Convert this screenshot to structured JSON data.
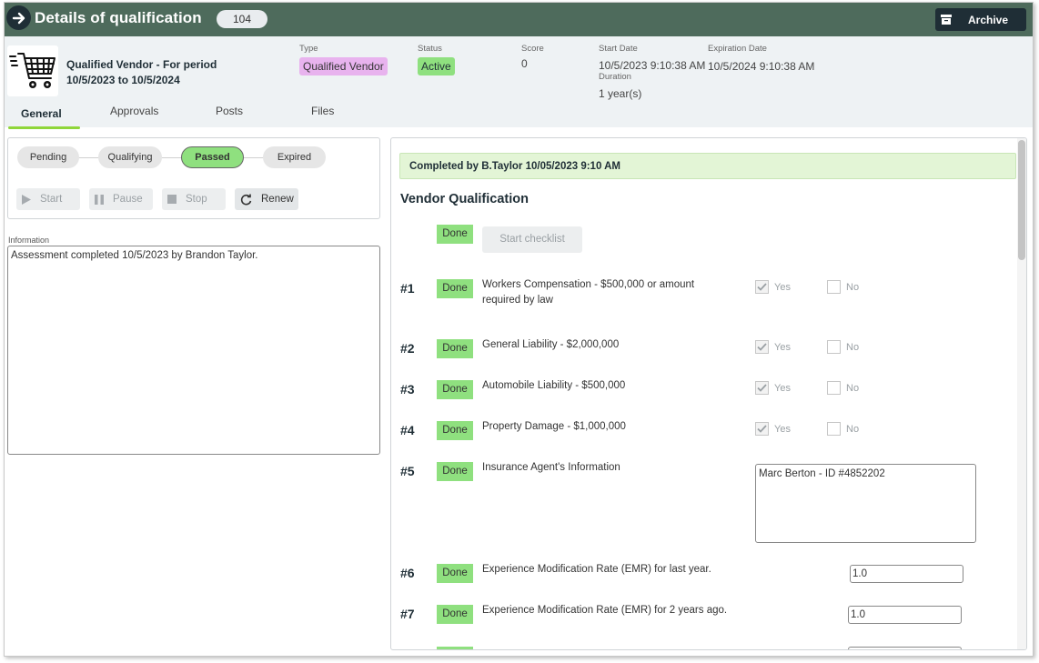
{
  "titlebar": {
    "title": "Details of qualification",
    "count": "104",
    "archive_label": "Archive"
  },
  "header": {
    "vendor_line1": "Qualified Vendor - For period",
    "vendor_line2": "10/5/2023 to 10/5/2024",
    "type_label": "Type",
    "type_value": "Qualified Vendor",
    "status_label": "Status",
    "status_value": "Active",
    "score_label": "Score",
    "score_value": "0",
    "start_date_label": "Start Date",
    "start_date_value": "10/5/2023 9:10:38 AM",
    "duration_label": "Duration",
    "duration_value": "1 year(s)",
    "expiration_label": "Expiration Date",
    "expiration_value": "10/5/2024 9:10:38 AM"
  },
  "tabs": [
    "General",
    "Approvals",
    "Posts",
    "Files"
  ],
  "stages": [
    "Pending",
    "Qualifying",
    "Passed",
    "Expired"
  ],
  "actions": {
    "start": "Start",
    "pause": "Pause",
    "stop": "Stop",
    "renew": "Renew"
  },
  "information": {
    "label": "Information",
    "text": "Assessment completed 10/5/2023 by Brandon Taylor."
  },
  "qualification": {
    "completed_banner": "Completed by B.Taylor 10/05/2023 9:10 AM",
    "title": "Vendor Qualification",
    "done_label": "Done",
    "start_checklist": "Start checklist",
    "yes_label": "Yes",
    "no_label": "No",
    "items": [
      {
        "num": "#1",
        "text": "Workers Compensation - $500,000 or amount required by law"
      },
      {
        "num": "#2",
        "text": "General Liability - $2,000,000"
      },
      {
        "num": "#3",
        "text": "Automobile Liability - $500,000"
      },
      {
        "num": "#4",
        "text": "Property Damage - $1,000,000"
      },
      {
        "num": "#5",
        "text": "Insurance Agent's Information",
        "value": "Marc Berton - ID #4852202"
      },
      {
        "num": "#6",
        "text": "Experience Modification Rate (EMR) for last year.",
        "value": "1.0"
      },
      {
        "num": "#7",
        "text": "Experience Modification Rate (EMR) for 2 years ago.",
        "value": "1.0"
      }
    ]
  },
  "colors": {
    "titlebar": "#4e6b5c",
    "done_green": "#8fe07f",
    "type_pink": "#e8b3ee",
    "dark": "#1f2e36"
  }
}
